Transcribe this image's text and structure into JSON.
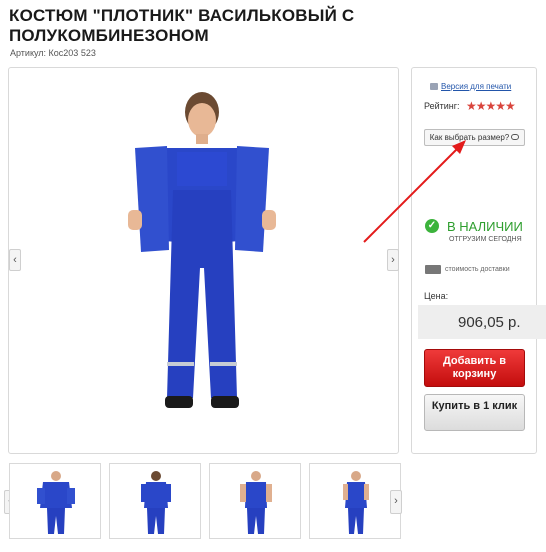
{
  "product": {
    "title": "КОСТЮМ \"ПЛОТНИК\" ВАСИЛЬКОВЫЙ С ПОЛУКОМБИНЕЗОНОМ",
    "article": "Артикул: Кос203 523"
  },
  "gallery": {
    "prev_icon": "‹",
    "next_icon": "›"
  },
  "sidebar": {
    "print_link": "Версия для печати",
    "rating_label": "Рейтинг:",
    "rating_stars": "★★★★★",
    "rating_value": 5,
    "size_button": "Как выбрать размер?",
    "stock_status": "В НАЛИЧИИ",
    "stock_check": "✓",
    "ship_note": "ОТГРУЗИМ СЕГОДНЯ",
    "delivery_link": "стоимость доставки",
    "price_label": "Цена:",
    "price": "906,05 р.",
    "add_to_cart": "Добавить в корзину",
    "buy_one_click": "Купить в 1 клик"
  },
  "thumbnails": {
    "prev_icon": "‹",
    "next_icon": "›",
    "count": 4
  },
  "colors": {
    "accent_red": "#d01414",
    "stock_green": "#2e9e2e",
    "suit_blue": "#2a47c9",
    "star_red": "#d9443c"
  }
}
